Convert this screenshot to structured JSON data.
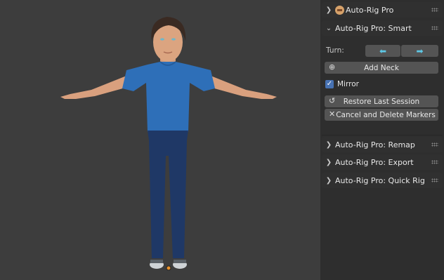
{
  "panel": {
    "header": {
      "label": "Auto-Rig Pro",
      "expanded": false,
      "icon": "armature-icon"
    },
    "smart": {
      "label": "Auto-Rig Pro: Smart",
      "expanded": true,
      "turn_label": "Turn:",
      "turn_left_icon": "turn-left-icon",
      "turn_right_icon": "turn-right-icon",
      "add_neck": "Add Neck",
      "mirror_label": "Mirror",
      "mirror_checked": true,
      "restore": "Restore Last Session",
      "cancel": "Cancel and Delete Markers"
    },
    "remap": {
      "label": "Auto-Rig Pro: Remap",
      "expanded": false
    },
    "export": {
      "label": "Auto-Rig Pro: Export",
      "expanded": false
    },
    "quick_rig": {
      "label": "Auto-Rig Pro: Quick Rig",
      "expanded": false
    }
  },
  "colors": {
    "viewport_bg": "#3d3d3d",
    "panel_bg": "#2e2e2e",
    "button_bg": "#545454",
    "checkbox_accent": "#4772b3",
    "shirt": "#2e6fb8",
    "pants": "#1f3866"
  }
}
